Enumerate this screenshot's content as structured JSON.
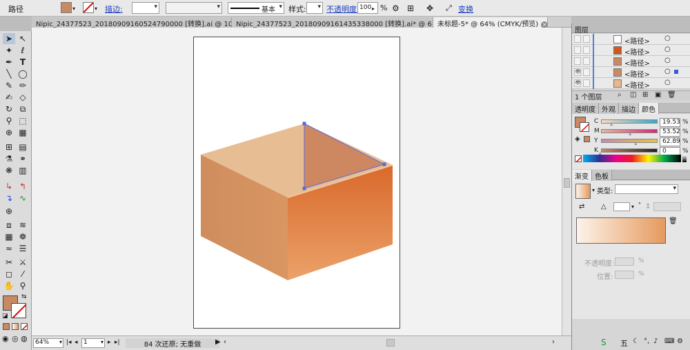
{
  "control_bar": {
    "object_type": "路径",
    "fill_color": "#c98a63",
    "stroke_label": "描边:",
    "stroke_style_label": "基本",
    "style_label": "样式:",
    "opacity_label": "不透明度:",
    "opacity_value": "100",
    "opacity_unit": "%",
    "transform_label": "变换"
  },
  "tabs": [
    {
      "label": "Nipic_24377523_20180909160524790000 [转换].ai @ 10..."
    },
    {
      "label": "Nipic_24377523_20180909161435338000 [转换].ai* @ 6..."
    },
    {
      "label": "未标题-5* @ 64% (CMYK/预览)"
    }
  ],
  "status_bar": {
    "zoom": "64%",
    "artboard_number": "1",
    "undo_text": "84 次还原; 无重做"
  },
  "layers_panel": {
    "title": "图层",
    "rows": [
      {
        "name": "<路径>",
        "thumb_color": "#ffffff"
      },
      {
        "name": "<路径>",
        "thumb_color": "#d2571f"
      },
      {
        "name": "<路径>",
        "thumb_color": "#c98a63"
      },
      {
        "name": "<路径>",
        "thumb_color": "#c98a63"
      },
      {
        "name": "<路径>",
        "thumb_color": "#e5b98e"
      }
    ],
    "footer_text": "1 个图层"
  },
  "color_panel": {
    "tabs": [
      "透明度",
      "外观",
      "描边",
      "颜色"
    ],
    "active_tab": "颜色",
    "channels": [
      {
        "label": "C",
        "value": "19.53",
        "fraction": 0.2
      },
      {
        "label": "M",
        "value": "53.52",
        "fraction": 0.53
      },
      {
        "label": "Y",
        "value": "62.89",
        "fraction": 0.63
      },
      {
        "label": "K",
        "value": "0",
        "fraction": 0.0
      }
    ]
  },
  "gradient_panel": {
    "tabs": [
      "渐变",
      "色板"
    ],
    "active_tab": "渐变",
    "type_label": "类型:",
    "opacity_label": "不透明度:",
    "location_label": "位置:",
    "percent": "%",
    "start_color": "#fdf3ea",
    "end_color": "#e59a5e"
  },
  "colors": {
    "box_top": "#e7be93",
    "box_left": "#cf8d5f",
    "box_front_top": "#d9692c",
    "box_front_bottom": "#eba269",
    "box_inner": "#cd8862",
    "path_selection": "#5b6ad6"
  }
}
